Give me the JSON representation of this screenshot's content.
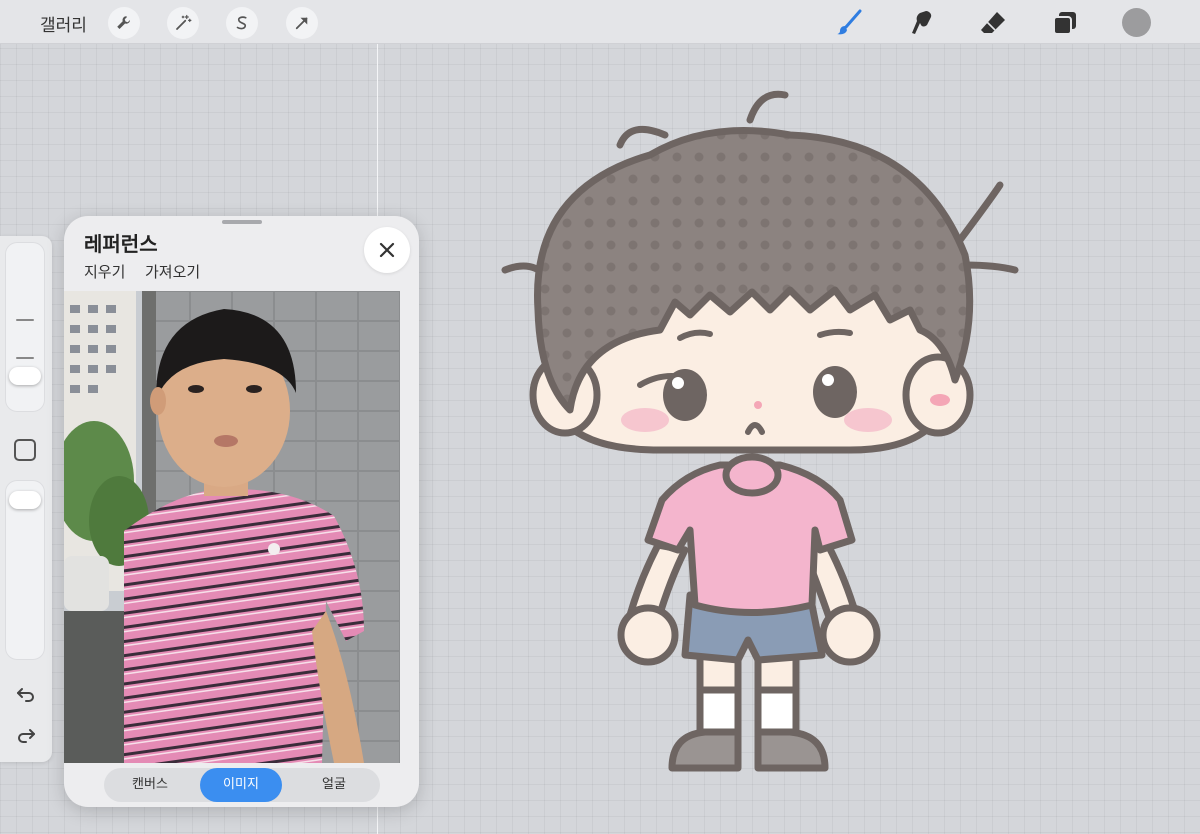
{
  "toolbar": {
    "gallery_label": "갤러리",
    "left_tools": [
      "wrench-icon",
      "magic-wand-icon",
      "selection-icon",
      "transform-arrow-icon"
    ],
    "right_tools": [
      "brush-icon",
      "smudge-icon",
      "eraser-icon",
      "layers-icon"
    ],
    "active_color": "#9c9c9e",
    "brush_active_color": "#2f7de1"
  },
  "sidebar": {
    "undo_icon": "undo-icon",
    "redo_icon": "redo-icon",
    "modify_icon": "square-modify-icon"
  },
  "reference_panel": {
    "title": "레퍼런스",
    "actions": [
      "지우기",
      "가져오기"
    ],
    "segments": [
      "캔버스",
      "이미지",
      "얼굴"
    ],
    "active_segment": "이미지"
  },
  "colors": {
    "accent": "#3b8ef0",
    "shirt_pink": "#f4b5cd",
    "hair_brown": "#8c8380",
    "outline": "#6e6562",
    "skin": "#fbeee3",
    "shorts_blue": "#8a9cb5"
  }
}
